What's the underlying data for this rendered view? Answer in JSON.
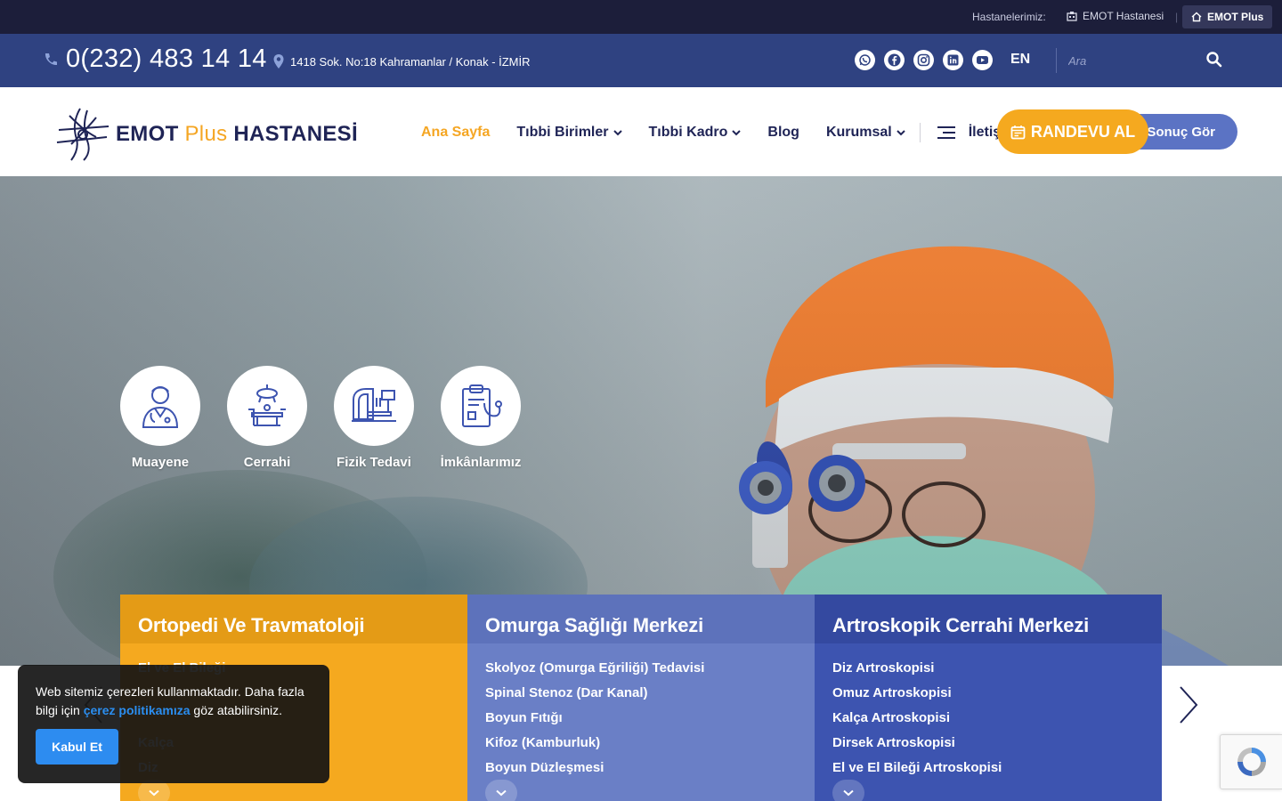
{
  "topbar": {
    "label": "Hastanelerimiz:",
    "hospital_1": "EMOT Hastanesi",
    "separator": "|",
    "hospital_2": "EMOT Plus"
  },
  "infobar": {
    "phone": "0(232) 483 14 14",
    "address": "1418 Sok. No:18 Kahramanlar / Konak - İZMİR",
    "socials": [
      "whatsapp-icon",
      "facebook-icon",
      "instagram-icon",
      "linkedin-icon",
      "youtube-icon"
    ],
    "lang": "EN",
    "search_placeholder": "Ara"
  },
  "header": {
    "logo_text_1": "EMOT",
    "logo_text_plus": "Plus",
    "logo_text_2": "HASTANESİ",
    "nav": [
      {
        "label": "Ana Sayfa",
        "dropdown": false,
        "active": true
      },
      {
        "label": "Tıbbi Birimler",
        "dropdown": true,
        "active": false
      },
      {
        "label": "Tıbbi Kadro",
        "dropdown": true,
        "active": false
      },
      {
        "label": "Blog",
        "dropdown": false,
        "active": false
      },
      {
        "label": "Kurumsal",
        "dropdown": true,
        "active": false
      }
    ],
    "contact_label": "İletişim",
    "appointment_label": "RANDEVU AL",
    "results_label": "Sonuç Gör"
  },
  "hero": {
    "features": [
      {
        "label": "Muayene",
        "icon": "doctor-icon"
      },
      {
        "label": "Cerrahi",
        "icon": "surgery-table-icon"
      },
      {
        "label": "Fizik Tedavi",
        "icon": "mri-scanner-icon"
      },
      {
        "label": "İmkânlarımız",
        "icon": "clipboard-stethoscope-icon"
      }
    ]
  },
  "cards": [
    {
      "title": "Ortopedi Ve Travmatoloji",
      "items": [
        "El ve El Bileği",
        "",
        "",
        "Kalça",
        "Diz"
      ]
    },
    {
      "title": "Omurga Sağlığı Merkezi",
      "items": [
        "Skolyoz (Omurga Eğriliği) Tedavisi",
        "Spinal Stenoz (Dar Kanal)",
        "Boyun Fıtığı",
        "Kifoz (Kamburluk)",
        "Boyun Düzleşmesi"
      ]
    },
    {
      "title": "Artroskopik Cerrahi Merkezi",
      "items": [
        "Diz Artroskopisi",
        "Omuz Artroskopisi",
        "Kalça Artroskopisi",
        "Dirsek Artroskopisi",
        "El ve El Bileği Artroskopisi"
      ]
    }
  ],
  "cookie": {
    "text_before": "Web sitemiz çerezleri kullanmaktadır. Daha fazla bilgi için ",
    "link": "çerez politikamıza",
    "text_after": " göz atabilirsiniz.",
    "accept": "Kabul Et"
  },
  "colors": {
    "topbar": "#1c1e3a",
    "infobar": "#2f4281",
    "accent_orange": "#f5a91f",
    "navy": "#1f2456",
    "card_blue_light": "#6a7fc6",
    "card_blue_dark": "#3d54b0"
  }
}
